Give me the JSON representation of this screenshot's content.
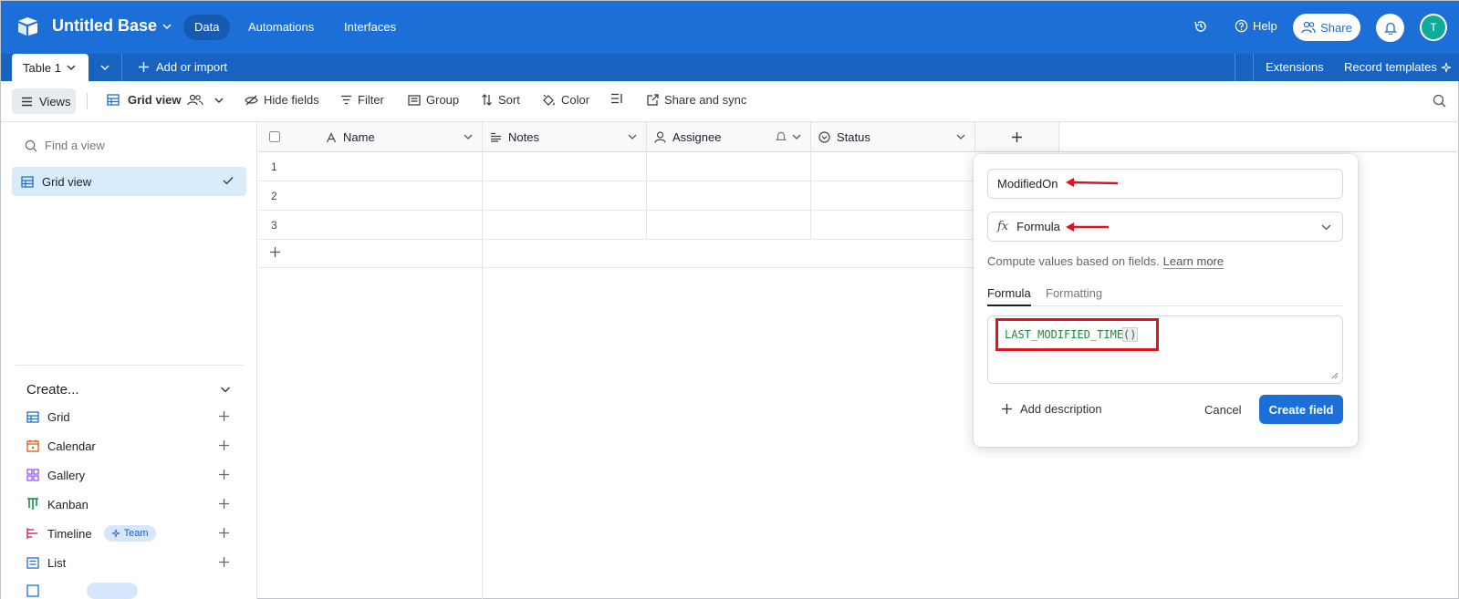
{
  "header": {
    "base_title": "Untitled Base",
    "nav": [
      "Data",
      "Automations",
      "Interfaces"
    ],
    "help": "Help",
    "share": "Share",
    "avatar_initial": "T"
  },
  "tabbar": {
    "table_tab": "Table 1",
    "add_import": "Add or import",
    "extensions": "Extensions",
    "record_templates": "Record templates"
  },
  "toolbar": {
    "views": "Views",
    "view_name": "Grid view",
    "hide_fields": "Hide fields",
    "filter": "Filter",
    "group": "Group",
    "sort": "Sort",
    "color": "Color",
    "share_sync": "Share and sync"
  },
  "sidebar": {
    "find_placeholder": "Find a view",
    "active_view": "Grid view",
    "create_heading": "Create...",
    "create_items": [
      {
        "label": "Grid",
        "icon": "grid-icon",
        "color": "#1b6fd6"
      },
      {
        "label": "Calendar",
        "icon": "calendar-icon",
        "color": "#d9591b"
      },
      {
        "label": "Gallery",
        "icon": "gallery-icon",
        "color": "#8b46ff"
      },
      {
        "label": "Kanban",
        "icon": "kanban-icon",
        "color": "#0a8a3c"
      },
      {
        "label": "Timeline",
        "icon": "timeline-icon",
        "color": "#d6336c",
        "badge": "Team"
      },
      {
        "label": "List",
        "icon": "list-icon",
        "color": "#1b6fd6"
      }
    ]
  },
  "grid": {
    "columns": [
      "Name",
      "Notes",
      "Assignee",
      "Status"
    ],
    "rows": [
      "1",
      "2",
      "3"
    ]
  },
  "field_popup": {
    "field_name": "ModifiedOn",
    "field_type": "Formula",
    "description": "Compute values based on fields.",
    "learn_more": "Learn more",
    "tabs": [
      "Formula",
      "Formatting"
    ],
    "formula_fn": "LAST_MODIFIED_TIME",
    "formula_parens": "()",
    "add_description": "Add description",
    "cancel": "Cancel",
    "create_field": "Create field"
  },
  "colors": {
    "brand": "#1b6fd6",
    "annotation": "#e0141f"
  }
}
